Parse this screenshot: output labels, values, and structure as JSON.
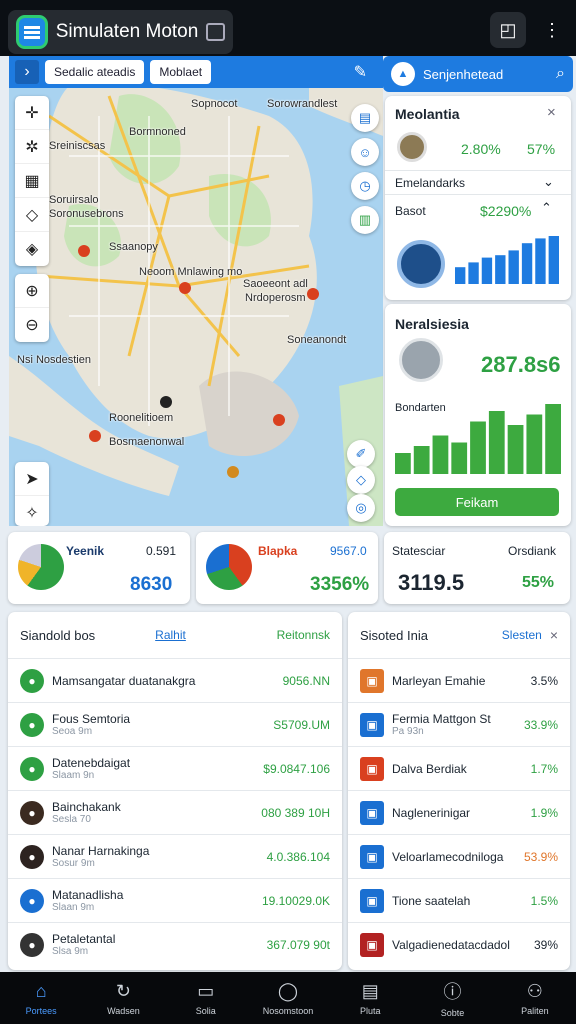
{
  "app": {
    "title": "Simulaten Moton"
  },
  "map": {
    "toolbar": {
      "chip1": "Sedalic ateadis",
      "chip2": "Moblaet"
    },
    "labels": [
      "Sopnocot",
      "Bormnoned",
      "Sreiniscsas",
      "Soruirsalo",
      "Soronusebrons",
      "Sorowrandlest",
      "Ssaanopy",
      "Neoom Mnlawing mo",
      "Saoeeont adl",
      "Nrdoperosm",
      "Soneanondt",
      "Nsi Nosdestien",
      "Roonelitioem",
      "Bosmaenonwal"
    ]
  },
  "right_panel": {
    "header": "Senjenhetead",
    "card1": {
      "title": "Meolantia",
      "v1": "2.80%",
      "v2": "57%",
      "row1": "Emelandarks",
      "row2_label": "Basot",
      "row2_value": "$2290%",
      "bars": [
        0.35,
        0.45,
        0.55,
        0.6,
        0.7,
        0.85,
        0.95,
        1.0
      ]
    },
    "card2": {
      "title": "Neralsiesia",
      "value": "287.8s6",
      "label": "Bondarten",
      "bars": [
        0.3,
        0.4,
        0.55,
        0.45,
        0.75,
        0.9,
        0.7,
        0.85,
        1.0
      ],
      "button": "Feikam"
    }
  },
  "stats": [
    {
      "title": "Yeenik",
      "top": "0.591",
      "value": "8630"
    },
    {
      "title": "Blapka",
      "top": "9567.0",
      "value": "3356%"
    },
    {
      "title": "Statesciar",
      "top": "Orsdiank",
      "value": "3119.5",
      "pct": "55%"
    }
  ],
  "list_left": {
    "title": "Siandold bos",
    "tab": "Ralhit",
    "tab2": "Reitonnsk",
    "rows": [
      {
        "name": "Mamsangatar duatanakgra",
        "sub": "",
        "value": "9056.NN",
        "icon_color": "#2ea043"
      },
      {
        "name": "Fous Semtoria",
        "sub": "Seoa 9m",
        "value": "S5709.UM",
        "icon_color": "#2ea043"
      },
      {
        "name": "Datenebdaigat",
        "sub": "Slaam 9n",
        "value": "$9.0847.106",
        "icon_color": "#2ea043"
      },
      {
        "name": "Bainchakank",
        "sub": "Sesla 70",
        "value": "080 389 10H",
        "icon_color": "#3b2a20"
      },
      {
        "name": "Nanar Harnakinga",
        "sub": "Sosur 9m",
        "value": "4.0.386.104",
        "icon_color": "#2d2320"
      },
      {
        "name": "Matanadlisha",
        "sub": "Slaan 9m",
        "value": "19.10029.0K",
        "icon_color": "#1a6fd1"
      },
      {
        "name": "Petaletantal",
        "sub": "Slsa 9m",
        "value": "367.079 90t",
        "icon_color": "#333"
      }
    ]
  },
  "list_right": {
    "title": "Sisoted Inia",
    "link": "Slesten",
    "rows": [
      {
        "name": "Marleyan Emahie",
        "sub": "",
        "value": "3.5%",
        "color": "#e0762b"
      },
      {
        "name": "Fermia Mattgon St",
        "sub": "Pa 93n",
        "value": "33.9%",
        "color": "#1a6fd1"
      },
      {
        "name": "Dalva Berdiak",
        "sub": "",
        "value": "1.7%",
        "color": "#d9401f"
      },
      {
        "name": "Naglenerinigar",
        "sub": "",
        "value": "1.9%",
        "color": "#1a6fd1"
      },
      {
        "name": "Veloarlamecodniloga",
        "sub": "",
        "value": "53.9%",
        "color": "#1a6fd1"
      },
      {
        "name": "Tione saatelah",
        "sub": "",
        "value": "1.5%",
        "color": "#1a6fd1"
      },
      {
        "name": "Valgadienedatacdadol",
        "sub": "",
        "value": "39%",
        "color": "#b22222"
      }
    ]
  },
  "nav": [
    "Portees",
    "Wadsen",
    "Solia",
    "Nosomstoon",
    "Pluta",
    "Sobte",
    "Paliten"
  ]
}
